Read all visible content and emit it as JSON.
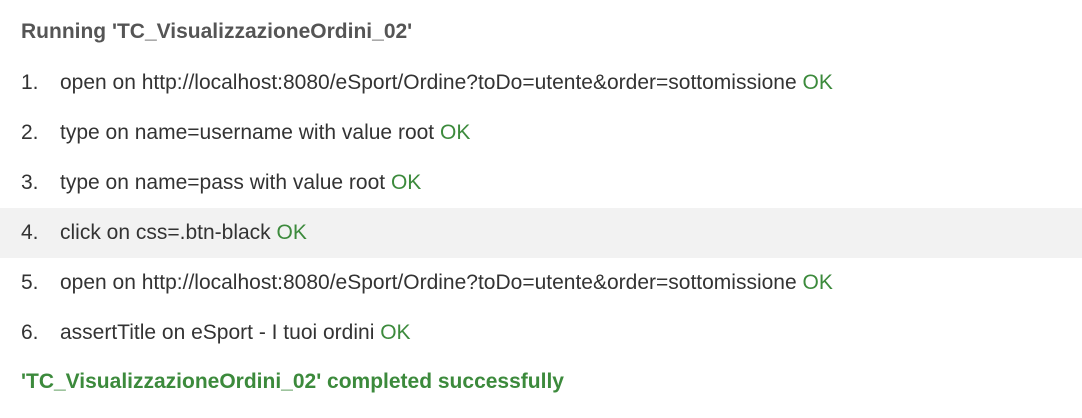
{
  "header": {
    "title": "Running 'TC_VisualizzazioneOrdini_02'"
  },
  "steps": [
    {
      "num": "1.",
      "text": "open on http://localhost:8080/eSport/Ordine?toDo=utente&order=sottomissione",
      "status": "OK"
    },
    {
      "num": "2.",
      "text": "type on name=username with value root",
      "status": "OK"
    },
    {
      "num": "3.",
      "text": "type on name=pass with value root",
      "status": "OK"
    },
    {
      "num": "4.",
      "text": "click on css=.btn-black",
      "status": "OK"
    },
    {
      "num": "5.",
      "text": "open on http://localhost:8080/eSport/Ordine?toDo=utente&order=sottomissione",
      "status": "OK"
    },
    {
      "num": "6.",
      "text": "assertTitle on eSport - I tuoi ordini",
      "status": "OK"
    }
  ],
  "footer": {
    "message": "'TC_VisualizzazioneOrdini_02' completed successfully"
  },
  "colors": {
    "success": "#3c8a3c",
    "highlight_row": "#f2f2f2"
  }
}
